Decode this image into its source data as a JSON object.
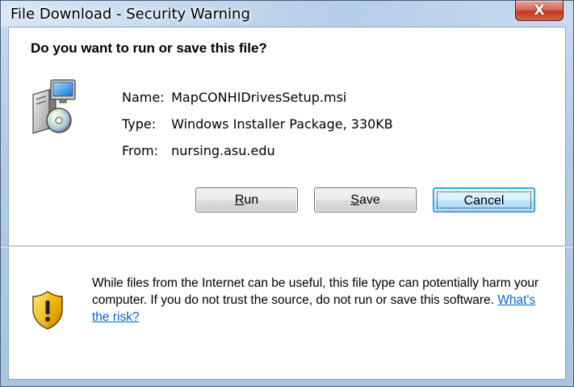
{
  "window": {
    "title": "File Download - Security Warning",
    "close_label": "X"
  },
  "dialog": {
    "question": "Do you want to run or save this file?",
    "file": {
      "name_label": "Name:",
      "name_value": "MapCONHIDrivesSetup.msi",
      "type_label": "Type:",
      "type_value": "Windows Installer Package, 330KB",
      "from_label": "From:",
      "from_value": "nursing.asu.edu",
      "icon": "windows-installer-icon"
    },
    "buttons": {
      "run_mnemonic": "R",
      "run_rest": "un",
      "save_mnemonic": "S",
      "save_rest": "ave",
      "cancel_label": "Cancel"
    },
    "warning": {
      "icon": "shield-warning-icon",
      "text": "While files from the Internet can be useful, this file type can potentially harm your computer. If you do not trust the source, do not run or save this software.",
      "link_text": "What's the risk?"
    }
  },
  "colors": {
    "link": "#0066cc",
    "close_button": "#c13a21",
    "shield": "#f0b400"
  }
}
